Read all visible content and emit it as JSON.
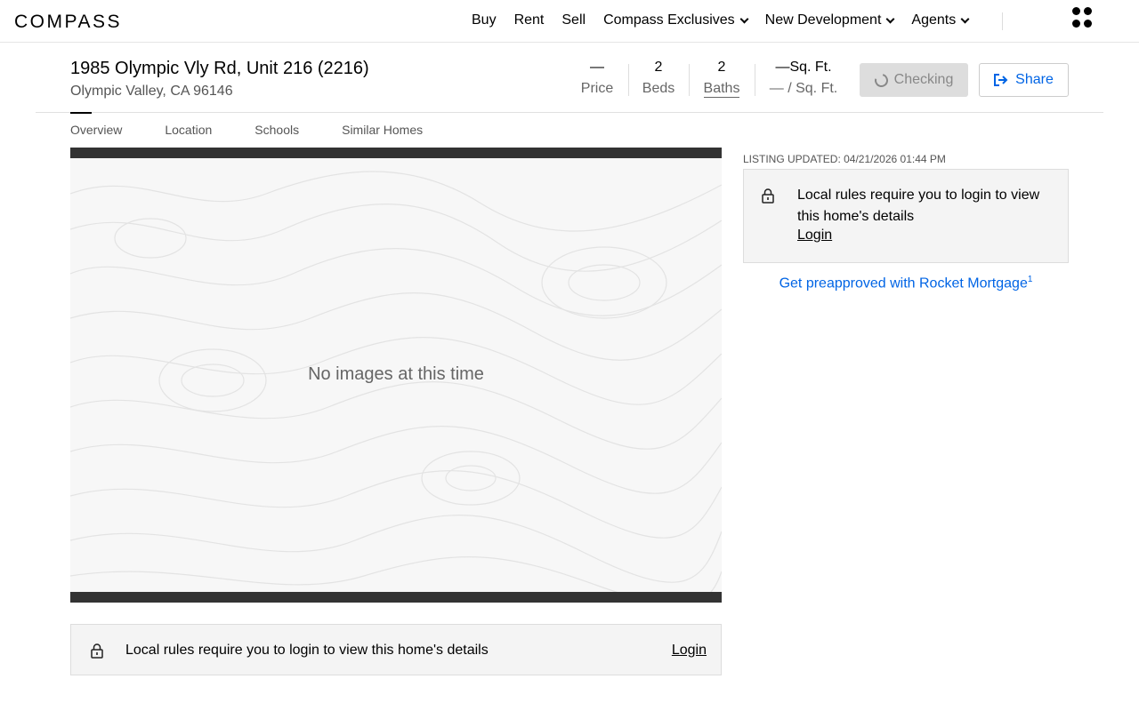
{
  "nav": {
    "logo": "COMPASS",
    "links": [
      "Buy",
      "Rent",
      "Sell",
      "Compass Exclusives",
      "New Development",
      "Agents"
    ]
  },
  "listing": {
    "address": "1985 Olympic Vly Rd, Unit 216 (2216)",
    "city": "Olympic Valley, CA 96146",
    "stats": {
      "price_value": "—",
      "price_label": "Price",
      "beds_value": "2",
      "beds_label": "Beds",
      "baths_value": "2",
      "baths_label": "Baths",
      "sqft_value": "—Sq. Ft.",
      "sqft_label": "— / Sq. Ft."
    },
    "checking_label": "Checking",
    "share_label": "Share"
  },
  "tabs": [
    "Overview",
    "Location",
    "Schools",
    "Similar Homes"
  ],
  "gallery": {
    "empty_text": "No images at this time"
  },
  "banner": {
    "message": "Local rules require you to login to view this home's details",
    "login": "Login"
  },
  "sidebar": {
    "updated": "LISTING UPDATED: 04/21/2026 01:44 PM",
    "message": "Local rules require you to login to view this home's details",
    "login": "Login",
    "mortgage": "Get preapproved with Rocket Mortgage",
    "mortgage_sup": "1"
  },
  "colors": {
    "link_blue": "#0064e5",
    "panel_bg": "#f4f4f4"
  }
}
